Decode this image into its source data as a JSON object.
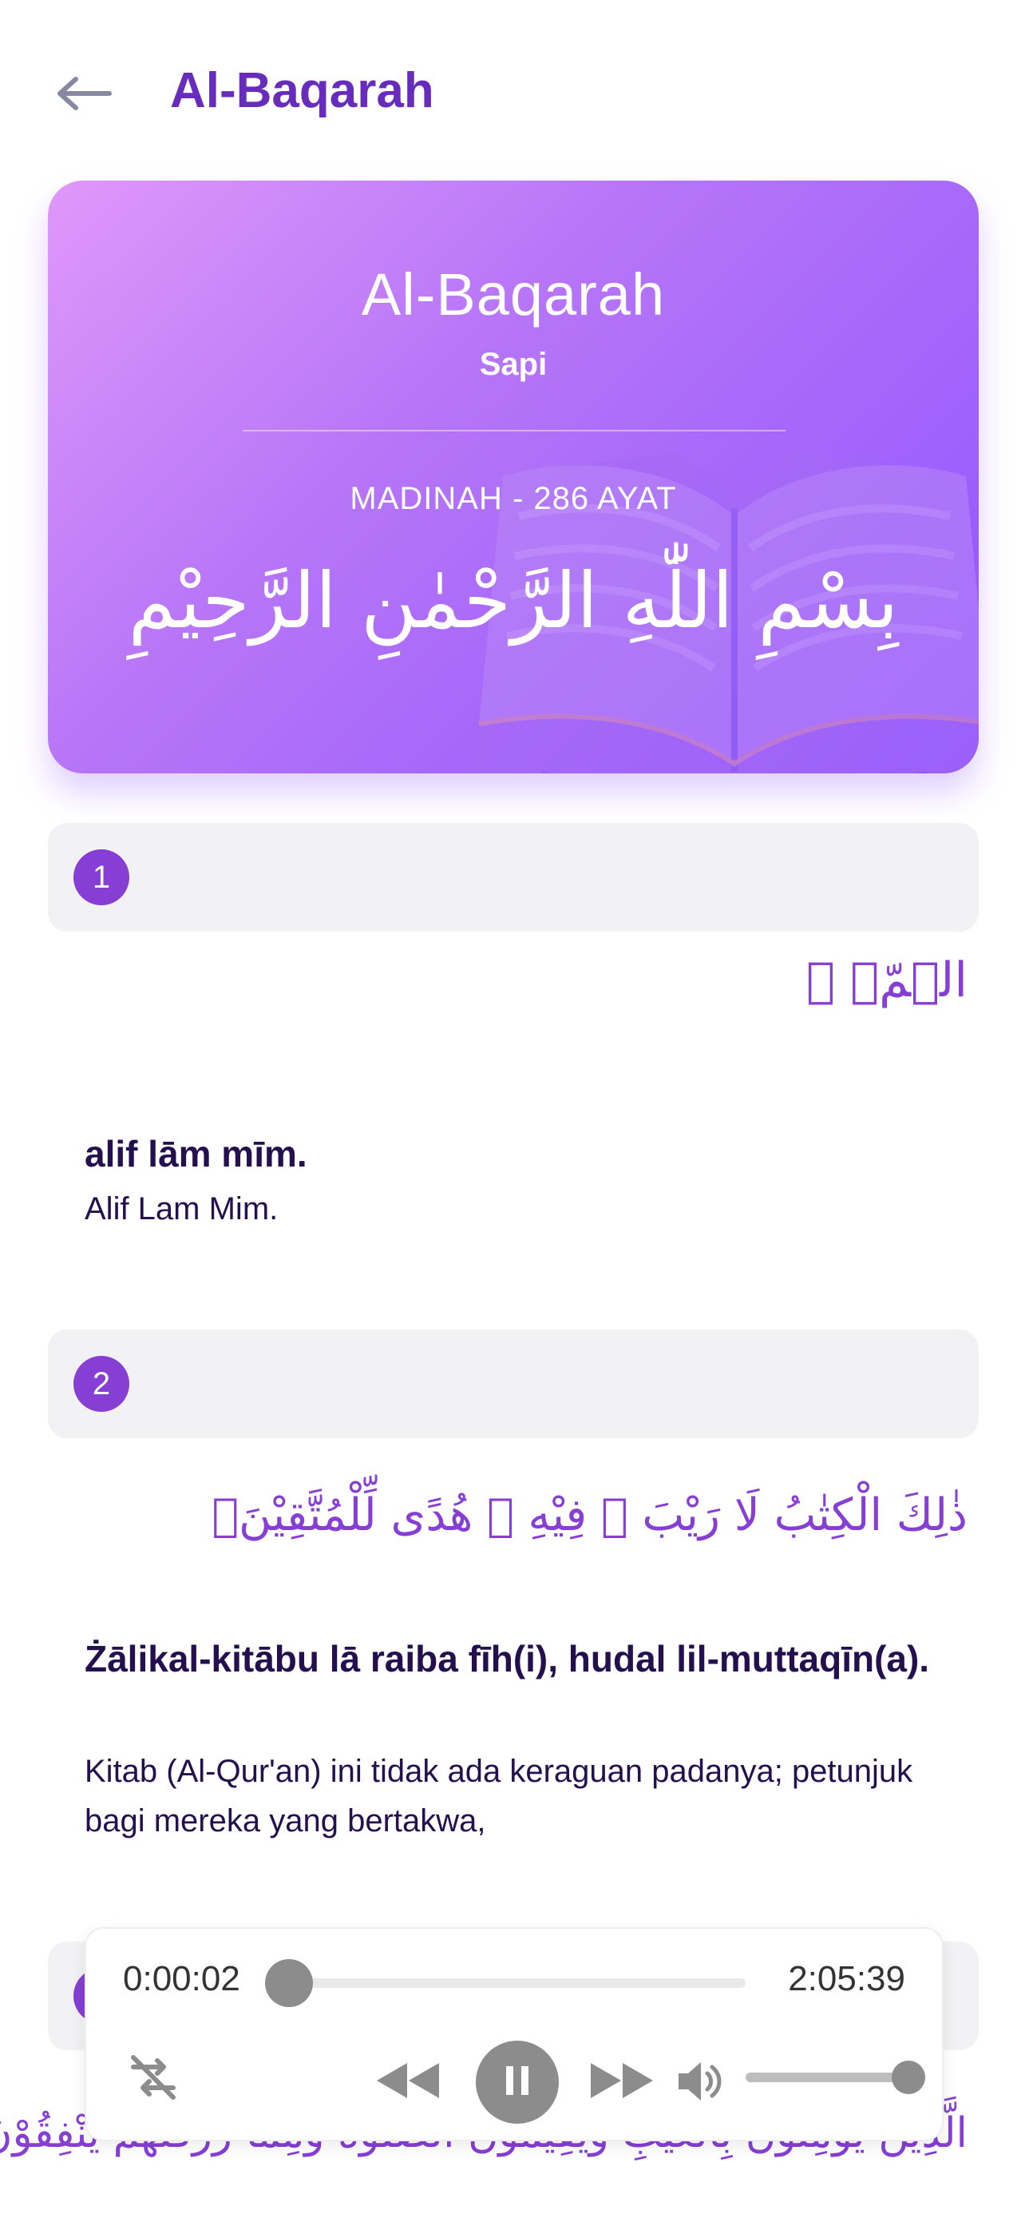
{
  "header": {
    "title": "Al-Baqarah",
    "back_icon": "arrow-left-icon"
  },
  "hero": {
    "name": "Al-Baqarah",
    "meaning": "Sapi",
    "meta": "MADINAH - 286 AYAT",
    "basmala": "بِسْمِ اللّٰهِ الرَّحْمٰنِ الرَّحِيْمِ",
    "gradient": [
      "#df98fa",
      "#9055ff"
    ]
  },
  "ayahs": [
    {
      "number": "1",
      "arabic": "الۤمّۤ ۚ",
      "latin": "alif lām mīm.",
      "translation": "Alif Lam Mim."
    },
    {
      "number": "2",
      "arabic": "ذٰلِكَ الْكِتٰبُ لَا رَيْبَ ۛ فِيْهِ ۛ هُدًى لِّلْمُتَّقِيْنَۙ",
      "latin": "Żālikal-kitābu lā raiba fīh(i), hudal lil-muttaqīn(a).",
      "translation": "Kitab (Al-Qur'an) ini tidak ada keraguan padanya; petunjuk bagi mereka yang bertakwa,"
    },
    {
      "number": "3",
      "arabic": "الَّذِيْنَ يُؤْمِنُوْنَ بِالْغَيْبِ وَيُقِيْمُوْنَ الصَّلٰوةَ وَمِمَّا رَزَقْنٰهُمْ يُنْفِقُوْنَۙ"
    }
  ],
  "player": {
    "current_time": "0:00:02",
    "total_time": "2:05:39",
    "progress": 0.0003,
    "volume": 1.0,
    "icons": [
      "shuffle-off-icon",
      "rewind-icon",
      "pause-icon",
      "fast-forward-icon",
      "volume-icon"
    ]
  },
  "colors": {
    "accent": "#672cbc",
    "ayah_number": "#863ed5",
    "arabic": "#863ed5",
    "text": "#240f4f",
    "player_control": "#8c8c8c"
  }
}
